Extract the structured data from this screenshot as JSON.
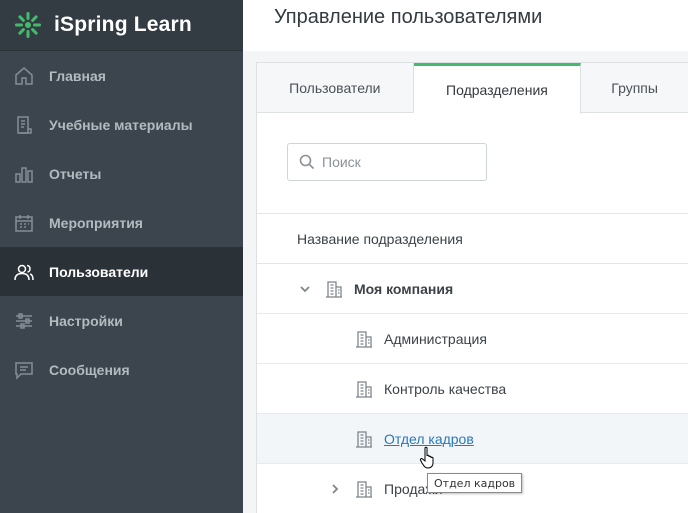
{
  "app": {
    "name": "iSpring Learn"
  },
  "sidebar": {
    "items": [
      {
        "label": "Главная",
        "icon": "home-icon",
        "active": false
      },
      {
        "label": "Учебные материалы",
        "icon": "document-icon",
        "active": false
      },
      {
        "label": "Отчеты",
        "icon": "bar-chart-icon",
        "active": false
      },
      {
        "label": "Мероприятия",
        "icon": "calendar-icon",
        "active": false
      },
      {
        "label": "Пользователи",
        "icon": "users-icon",
        "active": true
      },
      {
        "label": "Настройки",
        "icon": "sliders-icon",
        "active": false
      },
      {
        "label": "Сообщения",
        "icon": "message-icon",
        "active": false
      }
    ]
  },
  "header": {
    "title": "Управление пользователями"
  },
  "tabs": [
    {
      "label": "Пользователи",
      "active": false
    },
    {
      "label": "Подразделения",
      "active": true
    },
    {
      "label": "Группы",
      "active": false
    }
  ],
  "search": {
    "placeholder": "Поиск",
    "value": ""
  },
  "table": {
    "column_header": "Название подразделения",
    "rows": [
      {
        "label": "Моя компания",
        "level": 0,
        "expanded": true
      },
      {
        "label": "Администрация",
        "level": 1
      },
      {
        "label": "Контроль качества",
        "level": 1
      },
      {
        "label": "Отдел кадров",
        "level": 1,
        "hovered": true
      },
      {
        "label": "Продажи",
        "level": 1,
        "expanded": false
      }
    ]
  },
  "tooltip": {
    "text": "Отдел кадров"
  },
  "colors": {
    "sidebar_bg": "#3c454d",
    "sidebar_active_bg": "#2b3237",
    "accent": "#44bb6c",
    "link": "#2a78b8"
  }
}
